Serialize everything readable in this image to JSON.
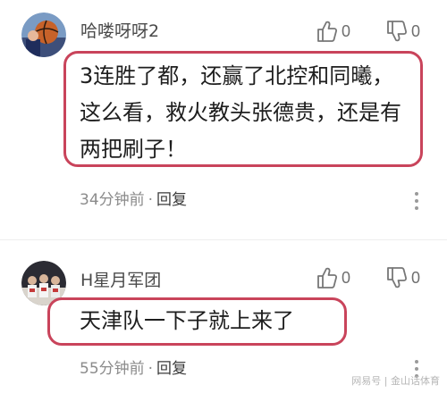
{
  "comments": [
    {
      "username": "哈喽呀呀2",
      "avatar_icon": "basketball-player-avatar",
      "likes": "0",
      "dislikes": "0",
      "text_lines": [
        "3连胜了都，还赢了北控和同曦，",
        "这么看，救火教头张德贵，还是有",
        "两把刷子！"
      ],
      "time": "34分钟前",
      "separator": "·",
      "reply_label": "回复"
    },
    {
      "username": "H星月军团",
      "avatar_icon": "team-photo-avatar",
      "likes": "0",
      "dislikes": "0",
      "text_lines": [
        "天津队一下子就上来了"
      ],
      "time": "55分钟前",
      "separator": "·",
      "reply_label": "回复"
    }
  ],
  "watermark": "网易号 | 金山话体育",
  "colors": {
    "highlight_border": "#c9445b",
    "meta_text": "#8b8b8b"
  }
}
